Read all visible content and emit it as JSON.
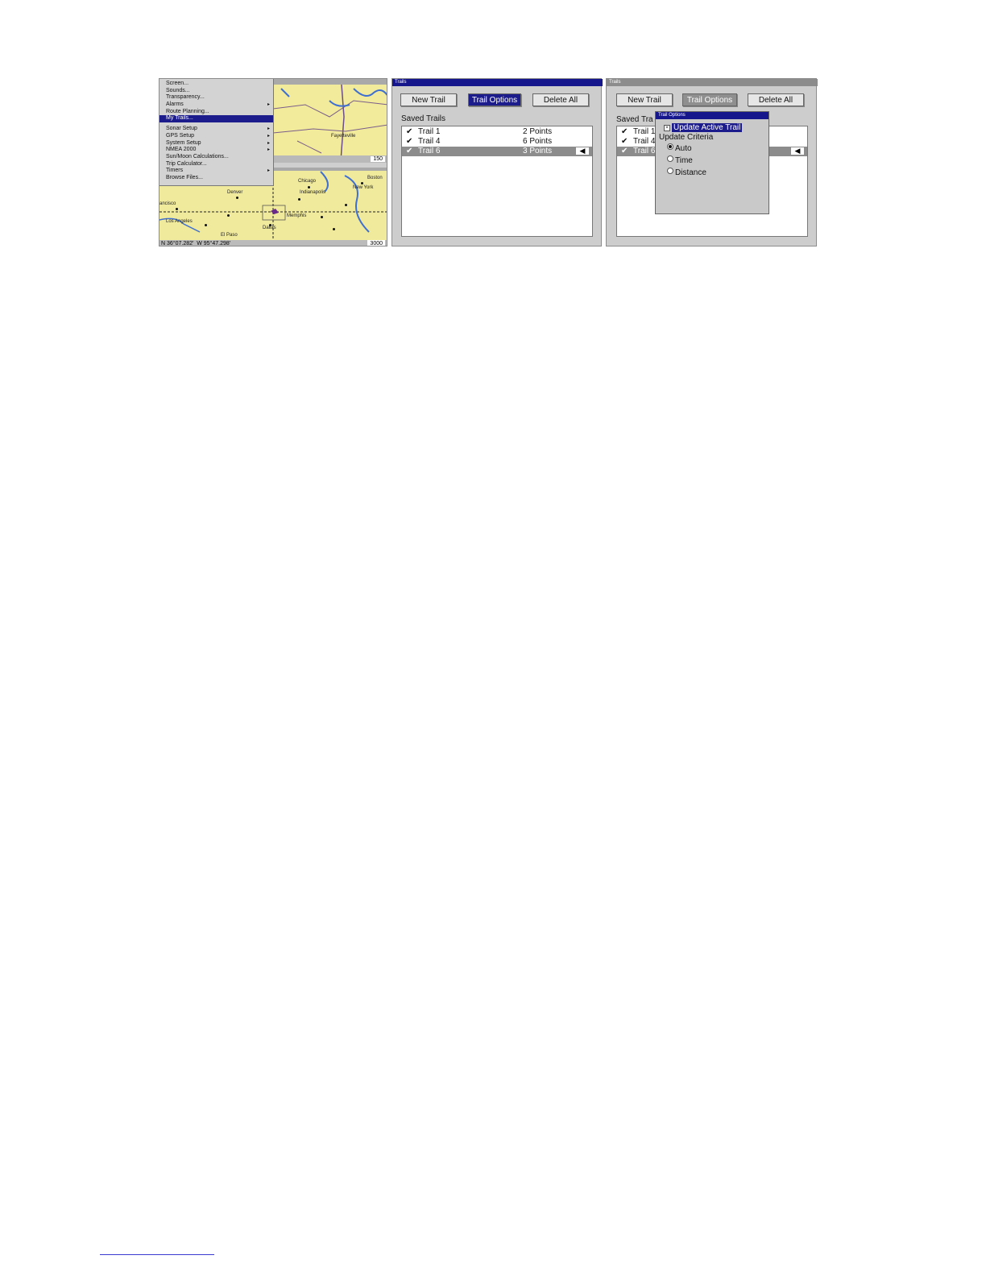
{
  "panel1": {
    "menu": {
      "items": [
        {
          "label": "Screen..."
        },
        {
          "label": "Sounds..."
        },
        {
          "label": "Transparency..."
        },
        {
          "label": "Alarms",
          "submenu": true
        },
        {
          "label": "Route Planning..."
        },
        {
          "label": "My Trails...",
          "selected": true
        },
        {
          "label": "Sonar Setup",
          "submenu": true
        },
        {
          "label": "GPS Setup",
          "submenu": true
        },
        {
          "label": "System Setup",
          "submenu": true
        },
        {
          "label": "NMEA 2000",
          "submenu": true
        },
        {
          "label": "Sun/Moon Calculations..."
        },
        {
          "label": "Trip Calculator..."
        },
        {
          "label": "Timers",
          "submenu": true
        },
        {
          "label": "Browse Files..."
        }
      ]
    },
    "map_top": {
      "scale": "150",
      "city": "Fayetteville"
    },
    "map_bottom": {
      "cities": [
        "Boston",
        "Chicago",
        "New York",
        "Denver",
        "Indianapolis",
        "ancisco",
        "Memphis",
        "Los Angeles",
        "Dallas",
        "El Paso"
      ],
      "lat": "N  36°07.282'",
      "lon": "W  95°47.298'",
      "scale": "3000"
    }
  },
  "panel2": {
    "title": "Trails",
    "buttons": {
      "new_trail": "New Trail",
      "trail_options": "Trail Options",
      "delete_all": "Delete All"
    },
    "saved_trails_label": "Saved Trails",
    "trails": [
      {
        "name": "Trail 1",
        "points": "2 Points"
      },
      {
        "name": "Trail 4",
        "points": "6 Points"
      },
      {
        "name": "Trail 6",
        "points": "3 Points",
        "selected": true
      }
    ]
  },
  "panel3": {
    "title": "Trails",
    "buttons": {
      "new_trail": "New Trail",
      "trail_options": "Trail Options",
      "delete_all": "Delete All"
    },
    "saved_trails_label": "Saved Tra",
    "trails": [
      {
        "name": "Trail 1"
      },
      {
        "name": "Trail 4"
      },
      {
        "name": "Trail 6",
        "selected": true
      }
    ],
    "popup": {
      "title": "Trail Options",
      "update_active_trail": "Update Active Trail",
      "update_criteria": "Update Criteria",
      "options": [
        "Auto",
        "Time",
        "Distance"
      ],
      "selected_option": "Auto"
    }
  },
  "colors": {
    "selection": "#1c1c8c",
    "dialog_bg": "#cdcdcd",
    "map_bg": "#f2eb9c"
  }
}
